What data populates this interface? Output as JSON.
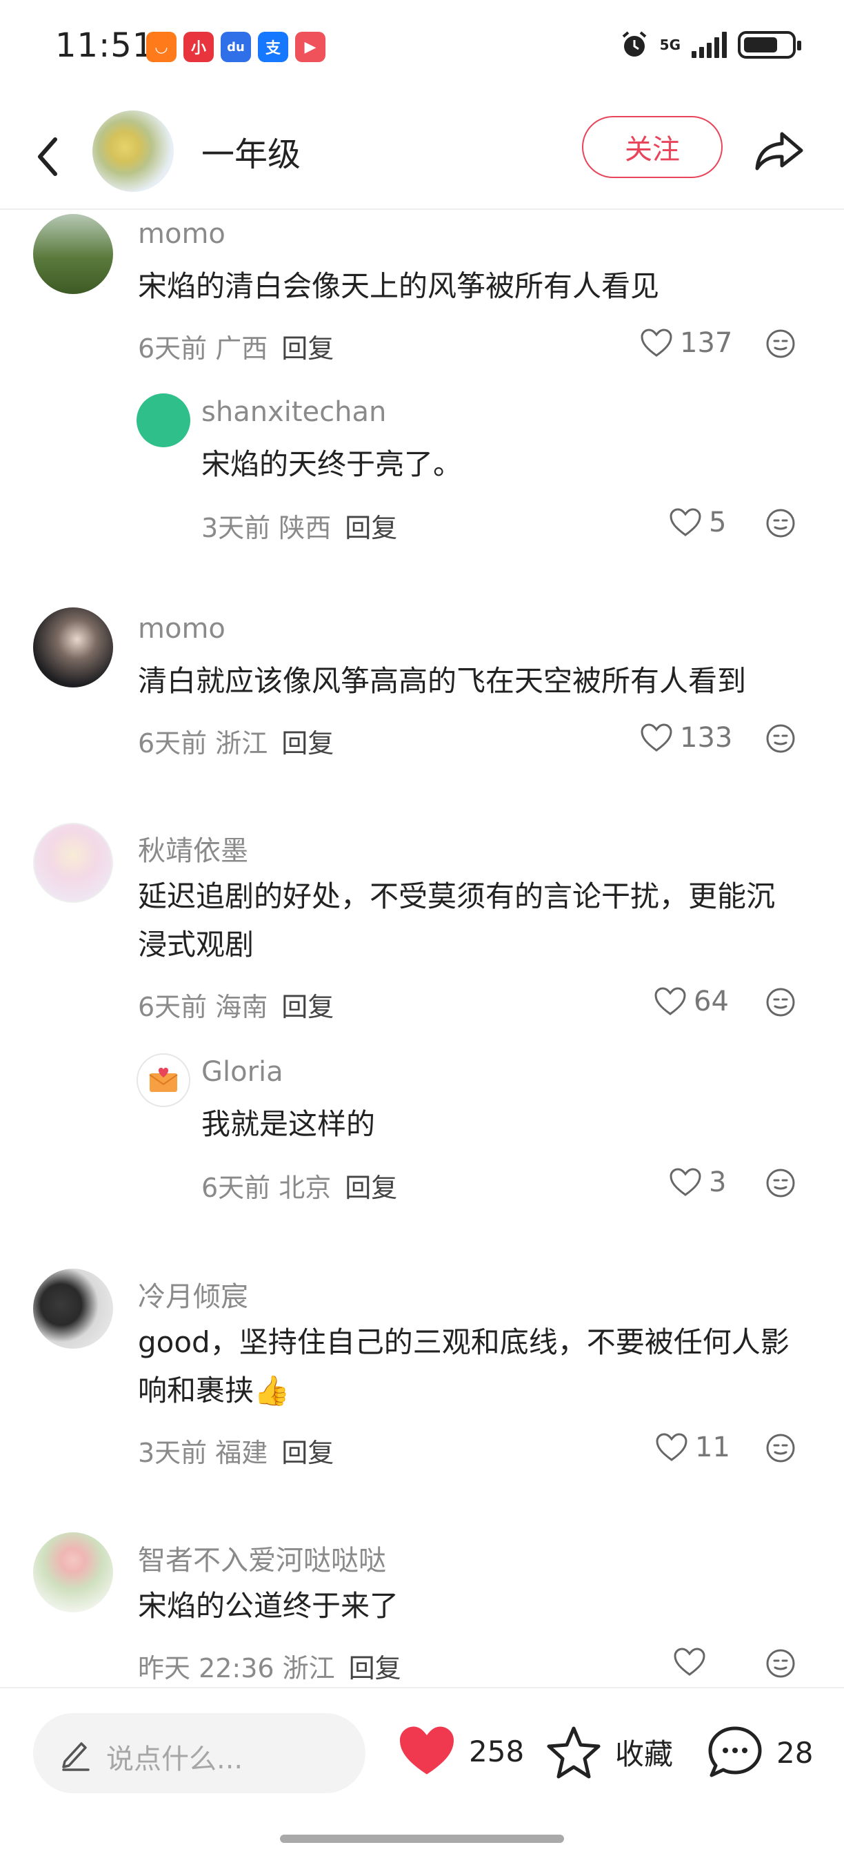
{
  "status_bar": {
    "time": "11:51",
    "network": "5G",
    "app_icons": [
      {
        "name": "taobao-icon",
        "glyph": "◡",
        "color": "#ff7a1a"
      },
      {
        "name": "xiaohongshu-books-icon",
        "glyph": "小",
        "color": "#e8343c"
      },
      {
        "name": "baidu-icon",
        "glyph": "du",
        "color": "#2f6fe8"
      },
      {
        "name": "alipay-icon",
        "glyph": "支",
        "color": "#1677ff"
      },
      {
        "name": "video-app-icon",
        "glyph": "▶",
        "color": "#f0525c"
      }
    ],
    "battery_level": 0.72
  },
  "header": {
    "title": "一年级",
    "follow_label": "关注"
  },
  "comments": [
    {
      "user": "momo",
      "text": "宋焰的清白会像天上的风筝被所有人看见",
      "meta": "6天前 广西",
      "reply_label": "回复",
      "likes": "137",
      "replies": [
        {
          "user": "shanxitechan",
          "text": "宋焰的天终于亮了。",
          "meta": "3天前 陕西",
          "reply_label": "回复",
          "likes": "5"
        }
      ]
    },
    {
      "user": "momo",
      "text": "清白就应该像风筝高高的飞在天空被所有人看到",
      "meta": "6天前 浙江",
      "reply_label": "回复",
      "likes": "133",
      "replies": []
    },
    {
      "user": "秋靖依墨",
      "text": "延迟追剧的好处，不受莫须有的言论干扰，更能沉浸式观剧",
      "meta": "6天前 海南",
      "reply_label": "回复",
      "likes": "64",
      "replies": [
        {
          "user": "Gloria",
          "text": "我就是这样的",
          "meta": "6天前 北京",
          "reply_label": "回复",
          "likes": "3"
        }
      ]
    },
    {
      "user": "冷月倾宸",
      "text": "good，坚持住自己的三观和底线，不要被任何人影响和裹挟👍",
      "meta": "3天前 福建",
      "reply_label": "回复",
      "likes": "11",
      "replies": []
    },
    {
      "user": "智者不入爱河哒哒哒",
      "text": "宋焰的公道终于来了",
      "meta": "昨天 22:36 浙江",
      "reply_label": "回复",
      "likes": "",
      "replies": []
    }
  ],
  "bottom_bar": {
    "input_placeholder": "说点什么...",
    "like_count": "258",
    "favorite_label": "收藏",
    "comment_count": "28"
  },
  "colors": {
    "accent": "#e8455a",
    "like_red": "#f0394f",
    "muted_text": "#8a8a8a"
  }
}
